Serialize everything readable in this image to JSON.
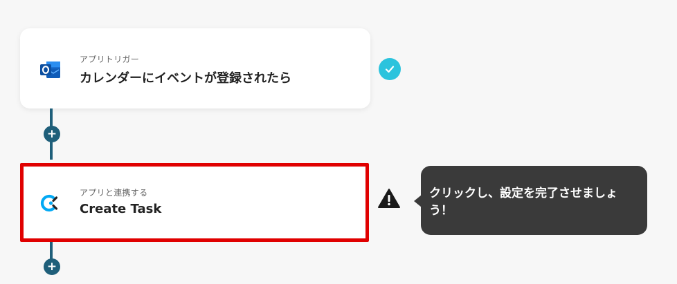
{
  "trigger_card": {
    "app_icon": "outlook-icon",
    "subtitle": "アプリトリガー",
    "title": "カレンダーにイベントが登録されたら",
    "status_icon": "check-icon"
  },
  "action_card": {
    "app_icon": "clockify-icon",
    "subtitle": "アプリと連携する",
    "title": "Create Task",
    "status_icon": "warning-icon"
  },
  "add_step_label": "+",
  "tooltip": {
    "text": "クリックし、設定を完了させましょう！"
  },
  "colors": {
    "connector": "#1f5f7a",
    "check": "#2bc3dd",
    "highlight_border": "#e00000",
    "tooltip_bg": "#3a3a3a"
  }
}
